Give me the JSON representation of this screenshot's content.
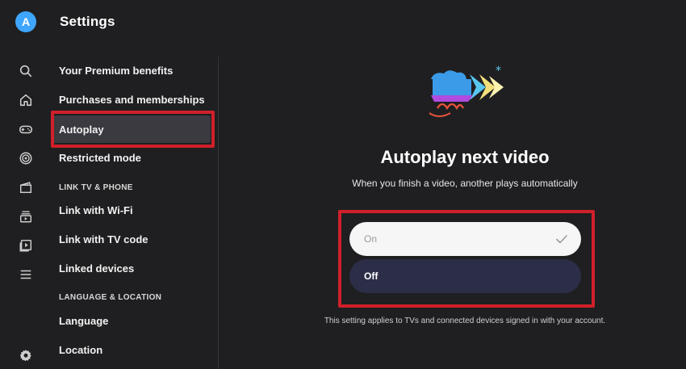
{
  "header": {
    "avatar_letter": "A",
    "title": "Settings"
  },
  "rail": {
    "icons": [
      "search-icon",
      "home-icon",
      "gaming-icon",
      "podcast-icon",
      "movies-icon",
      "subscriptions-icon",
      "library-icon",
      "menu-icon",
      "gear-icon"
    ]
  },
  "nav": {
    "items": {
      "premium": "Your Premium benefits",
      "purchases": "Purchases and memberships",
      "autoplay": "Autoplay",
      "restricted": "Restricted mode",
      "link_wifi": "Link with Wi-Fi",
      "link_code": "Link with TV code",
      "linked_devices": "Linked devices",
      "language": "Language",
      "location": "Location"
    },
    "sections": {
      "link_tv_phone": "LINK TV & PHONE",
      "language_location": "LANGUAGE & LOCATION"
    },
    "selected": "autoplay"
  },
  "main": {
    "title": "Autoplay next video",
    "subtitle": "When you finish a video, another plays automatically",
    "options": {
      "on": "On",
      "off": "Off"
    },
    "checked_option": "on",
    "focused_option": "off",
    "footnote": "This setting applies to TVs and connected devices signed in with your account."
  },
  "colors": {
    "highlight": "#d0202a",
    "background": "#1f1f21",
    "avatar": "#3ea6ff",
    "focused_option_bg": "#2c2e48"
  }
}
